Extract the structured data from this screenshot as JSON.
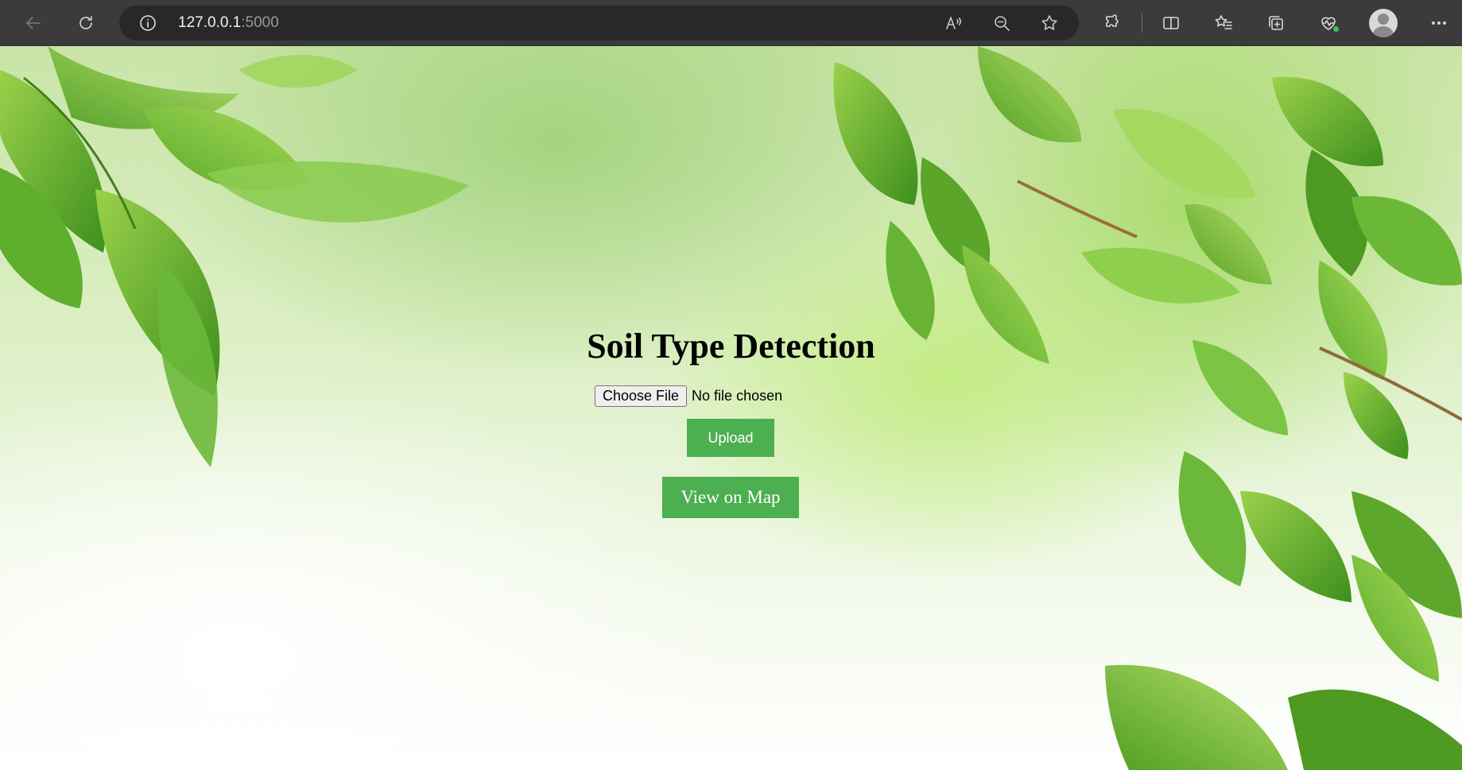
{
  "browser": {
    "url_host": "127.0.0.1",
    "url_port": ":5000",
    "toolbar_icons": [
      "back-icon",
      "refresh-icon",
      "site-info-icon",
      "read-aloud-icon",
      "zoom-out-icon",
      "favorite-star-icon",
      "extensions-icon",
      "split-screen-icon",
      "favorites-icon",
      "collections-icon",
      "browser-essentials-icon",
      "profile-avatar",
      "more-menu-icon"
    ]
  },
  "page": {
    "title": "Soil Type Detection",
    "choose_file_label": "Choose File",
    "no_file_text": "No file chosen",
    "upload_label": "Upload",
    "view_map_label": "View on Map",
    "button_color": "#4caf50"
  }
}
